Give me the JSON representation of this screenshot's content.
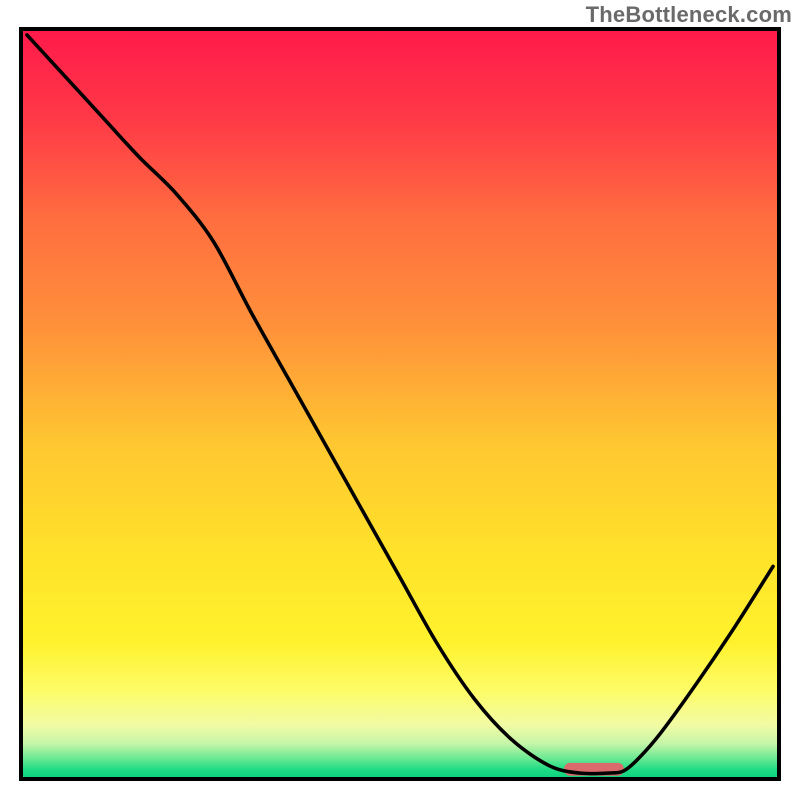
{
  "watermark": "TheBottleneck.com",
  "chart_data": {
    "type": "line",
    "title": "",
    "xlabel": "",
    "ylabel": "",
    "xlim": [
      0,
      100
    ],
    "ylim": [
      0,
      100
    ],
    "grid": false,
    "series": [
      {
        "name": "curve",
        "x": [
          0,
          5,
          10,
          15,
          20,
          25,
          30,
          35,
          40,
          45,
          50,
          55,
          60,
          65,
          70,
          74,
          78,
          80,
          82,
          85,
          90,
          95,
          100
        ],
        "values": [
          100,
          94.5,
          89.0,
          83.5,
          78.5,
          72.0,
          62.5,
          53.5,
          44.5,
          35.5,
          26.5,
          17.5,
          10.0,
          4.5,
          1.0,
          0.0,
          0.0,
          0.3,
          2.0,
          5.5,
          12.5,
          20.0,
          28.0
        ]
      }
    ],
    "marker": {
      "x_start": 72,
      "x_end": 80,
      "y": 0.5,
      "color": "#da6a6b"
    },
    "background_gradient": {
      "stops": [
        {
          "pct": 0.0,
          "color": "#ff1a4a"
        },
        {
          "pct": 0.12,
          "color": "#ff3a47"
        },
        {
          "pct": 0.25,
          "color": "#ff6d3f"
        },
        {
          "pct": 0.4,
          "color": "#ff923a"
        },
        {
          "pct": 0.55,
          "color": "#ffc631"
        },
        {
          "pct": 0.7,
          "color": "#ffe22a"
        },
        {
          "pct": 0.82,
          "color": "#fff22d"
        },
        {
          "pct": 0.885,
          "color": "#fdfc68"
        },
        {
          "pct": 0.93,
          "color": "#f2fba4"
        },
        {
          "pct": 0.955,
          "color": "#c6f5a8"
        },
        {
          "pct": 0.975,
          "color": "#6be993"
        },
        {
          "pct": 0.99,
          "color": "#1fdb85"
        },
        {
          "pct": 1.0,
          "color": "#0fd37f"
        }
      ]
    }
  }
}
